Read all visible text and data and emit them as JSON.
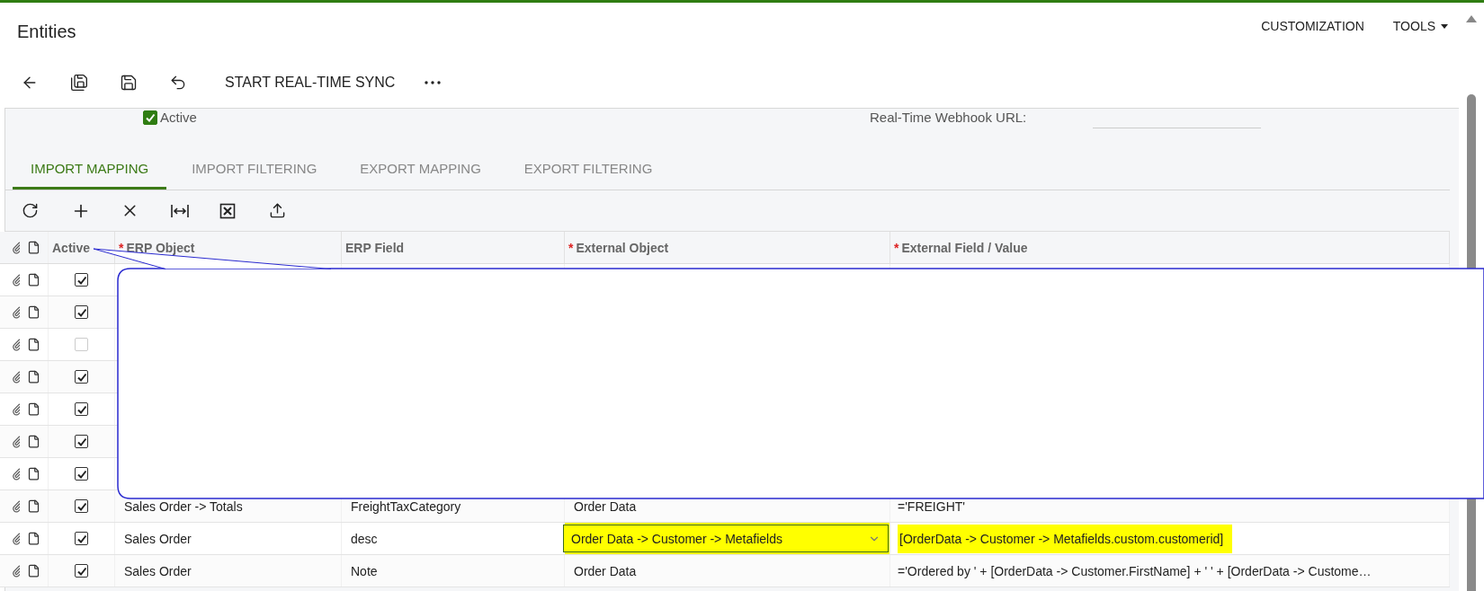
{
  "header": {
    "title": "Entities",
    "links": [
      {
        "label": "CUSTOMIZATION",
        "dropdown": false
      },
      {
        "label": "TOOLS",
        "dropdown": true
      }
    ]
  },
  "toolbar": {
    "action": "START REAL-TIME SYNC"
  },
  "form": {
    "active": {
      "label": "Active",
      "checked": true
    },
    "webhook": {
      "label": "Real-Time Webhook URL:"
    }
  },
  "tabs": [
    {
      "label": "IMPORT MAPPING",
      "selected": true
    },
    {
      "label": "IMPORT FILTERING",
      "selected": false
    },
    {
      "label": "EXPORT MAPPING",
      "selected": false
    },
    {
      "label": "EXPORT FILTERING",
      "selected": false
    }
  ],
  "grid": {
    "columns": [
      {
        "label": "Active"
      },
      {
        "label": "ERP Object",
        "required_mark": "*"
      },
      {
        "label": "ERP Field"
      },
      {
        "label": "External Object",
        "required_mark": "*"
      },
      {
        "label": "External Field / Value",
        "required_mark": "*"
      }
    ],
    "rows": [
      {
        "active": true
      },
      {
        "active": true
      },
      {
        "active": false
      },
      {
        "active": true
      },
      {
        "active": true
      },
      {
        "active": true
      },
      {
        "active": true
      },
      {
        "active": true,
        "erp_object": "Sales Order -> Totals",
        "erp_field": "FreightTaxCategory",
        "external_object": "Order Data",
        "external_field": "='FREIGHT'",
        "editing": false,
        "highlighted": false
      },
      {
        "active": true,
        "erp_object": "Sales Order",
        "erp_field": "desc",
        "external_object": "Order Data -> Customer -> Metafields",
        "external_field": "[OrderData -> Customer -> Metafields.custom.customerid]",
        "editing": true,
        "highlighted": true
      },
      {
        "active": true,
        "erp_object": "Sales Order",
        "erp_field": "Note",
        "external_object": "Order Data",
        "external_field": "='Ordered by ' + [OrderData -> Customer.FirstName] + ' ' + [OrderData -> Custome…",
        "editing": false,
        "highlighted": false
      }
    ]
  }
}
